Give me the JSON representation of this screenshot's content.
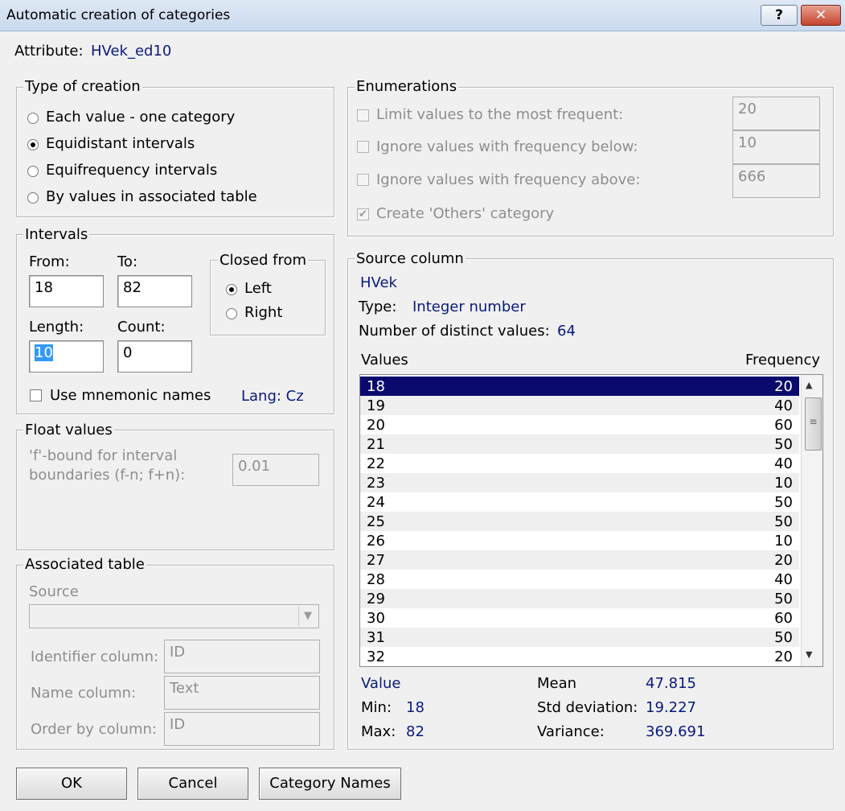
{
  "window": {
    "title": "Automatic creation of categories",
    "help": "?",
    "close": "✕"
  },
  "attribute": {
    "label": "Attribute:",
    "value": "HVek_ed10"
  },
  "type_of_creation": {
    "legend": "Type of creation",
    "options": [
      {
        "label": "Each value - one category",
        "selected": false
      },
      {
        "label": "Equidistant intervals",
        "selected": true
      },
      {
        "label": "Equifrequency intervals",
        "selected": false
      },
      {
        "label": "By values in associated table",
        "selected": false
      }
    ]
  },
  "intervals": {
    "legend": "Intervals",
    "from_label": "From:",
    "from_value": "18",
    "to_label": "To:",
    "to_value": "82",
    "length_label": "Length:",
    "length_value": "10",
    "count_label": "Count:",
    "count_value": "0",
    "closed_from": {
      "legend": "Closed from",
      "left": "Left",
      "right": "Right",
      "selected": "Left"
    },
    "mnemonic_label": "Use mnemonic names",
    "lang": "Lang: Cz"
  },
  "float_values": {
    "legend": "Float values",
    "label_line1": "'f'-bound for interval",
    "label_line2": "boundaries (f-n; f+n):",
    "value": "0.01"
  },
  "associated_table": {
    "legend": "Associated table",
    "source_label": "Source",
    "source_value": "",
    "identifier_label": "Identifier column:",
    "identifier_value": "ID",
    "name_label": "Name column:",
    "name_value": "Text",
    "order_label": "Order by column:",
    "order_value": "ID"
  },
  "enumerations": {
    "legend": "Enumerations",
    "items": [
      {
        "label": "Limit values to the most frequent:",
        "value": "20",
        "checked": false
      },
      {
        "label": "Ignore values with frequency below:",
        "value": "10",
        "checked": false
      },
      {
        "label": "Ignore values with frequency above:",
        "value": "666",
        "checked": false
      }
    ],
    "others_label": "Create 'Others' category",
    "others_checked": true
  },
  "source_column": {
    "legend": "Source column",
    "name": "HVek",
    "type_label": "Type:",
    "type_value": "Integer number",
    "distinct_label": "Number of distinct values:",
    "distinct_value": "64",
    "values_header": "Values",
    "frequency_header": "Frequency",
    "rows": [
      {
        "value": "18",
        "frequency": "20"
      },
      {
        "value": "19",
        "frequency": "40"
      },
      {
        "value": "20",
        "frequency": "60"
      },
      {
        "value": "21",
        "frequency": "50"
      },
      {
        "value": "22",
        "frequency": "40"
      },
      {
        "value": "23",
        "frequency": "10"
      },
      {
        "value": "24",
        "frequency": "50"
      },
      {
        "value": "25",
        "frequency": "50"
      },
      {
        "value": "26",
        "frequency": "10"
      },
      {
        "value": "27",
        "frequency": "20"
      },
      {
        "value": "28",
        "frequency": "40"
      },
      {
        "value": "29",
        "frequency": "50"
      },
      {
        "value": "30",
        "frequency": "60"
      },
      {
        "value": "31",
        "frequency": "50"
      },
      {
        "value": "32",
        "frequency": "20"
      }
    ],
    "stats": {
      "value_label": "Value",
      "min_label": "Min:",
      "min_value": "18",
      "max_label": "Max:",
      "max_value": "82",
      "mean_label": "Mean",
      "mean_value": "47.815",
      "std_label": "Std deviation:",
      "std_value": "19.227",
      "var_label": "Variance:",
      "var_value": "369.691"
    }
  },
  "buttons": {
    "ok": "OK",
    "cancel": "Cancel",
    "category_names": "Category Names"
  },
  "colors": {
    "accent": "#0a1a7a",
    "selection": "#0a0a6e",
    "text_selection": "#3399ff"
  }
}
